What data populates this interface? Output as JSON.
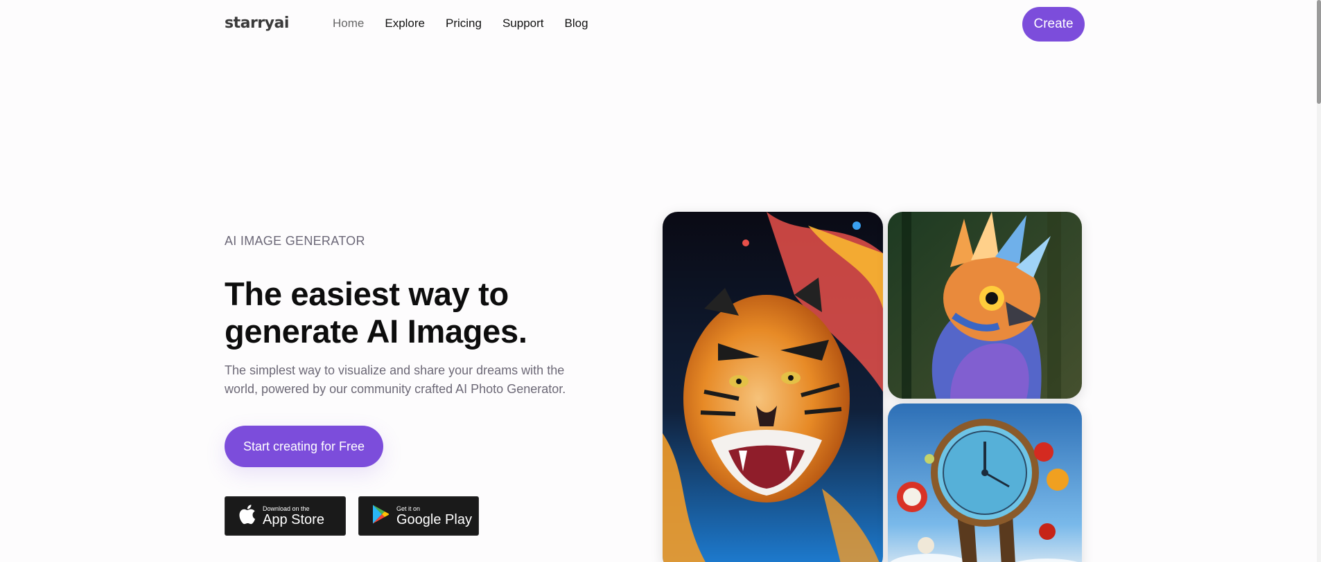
{
  "header": {
    "logo": "starryai",
    "nav": [
      {
        "label": "Home",
        "active": true
      },
      {
        "label": "Explore"
      },
      {
        "label": "Pricing"
      },
      {
        "label": "Support"
      },
      {
        "label": "Blog"
      }
    ],
    "create_label": "Create"
  },
  "hero": {
    "eyebrow": "AI IMAGE GENERATOR",
    "title_line1": "The easiest way to",
    "title_line2": "generate AI Images.",
    "subtitle_line1": "The simplest way to visualize and share your dreams with the",
    "subtitle_line2": "world, powered by our community crafted AI Photo Generator.",
    "cta_label": "Start creating for Free"
  },
  "stores": {
    "apple": {
      "small": "Download on the",
      "big": "App Store",
      "icon": "apple-icon"
    },
    "google": {
      "small": "Get it on",
      "big": "Google Play",
      "icon": "google-play-icon"
    }
  },
  "gallery": [
    {
      "name": "tiger-image"
    },
    {
      "name": "bird-image"
    },
    {
      "name": "melting-clock-image"
    }
  ],
  "colors": {
    "accent": "#7c4ddb",
    "background": "#fdfcfd",
    "muted_text": "#6c6876"
  }
}
